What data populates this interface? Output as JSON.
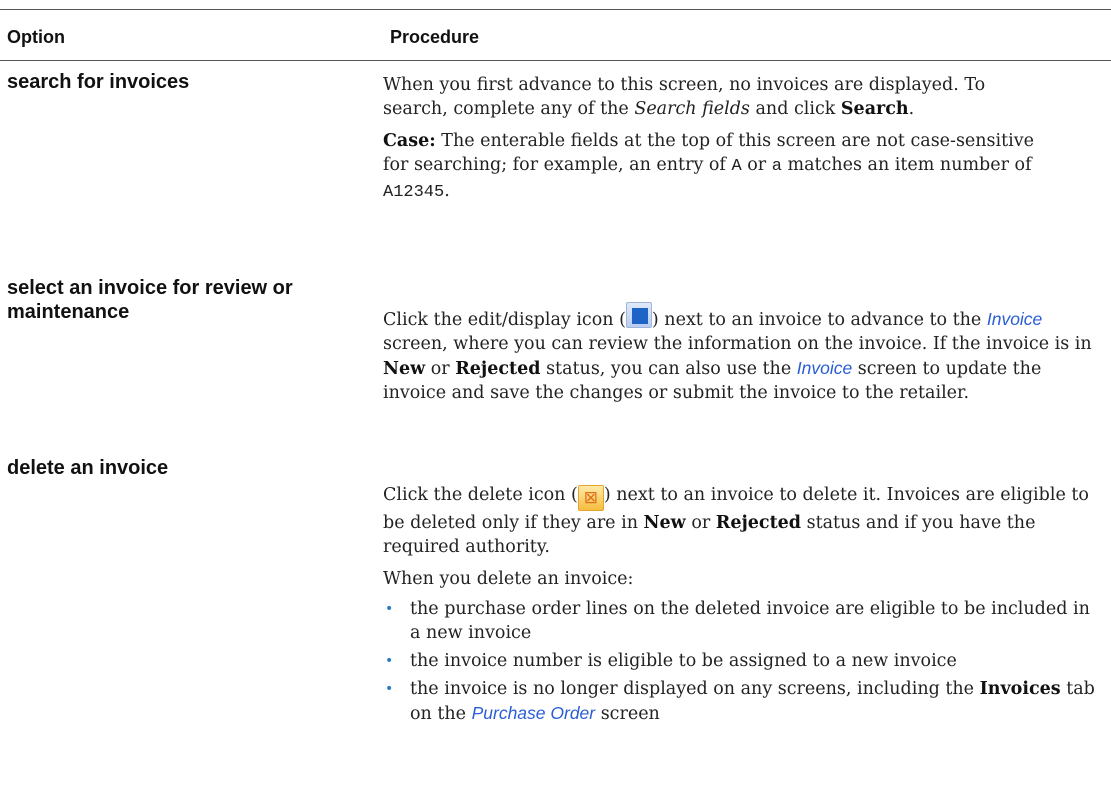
{
  "table": {
    "headers": {
      "option": "Option",
      "procedure": "Procedure"
    },
    "rows": {
      "search": {
        "option": "search for invoices",
        "p1": {
          "t1": "When you first advance to this screen, no invoices are displayed. To search, complete any of the ",
          "em": "Search fields",
          "t2": " and click ",
          "b": "Search",
          "t3": "."
        },
        "p2": {
          "label": "Case:",
          "t1": " The enterable fields at the top of this screen are not case-sensitive for searching; for example, an entry of ",
          "code1": "A",
          "t2": " or ",
          "code2": "a",
          "t3": " matches an item number of ",
          "code3": "A12345",
          "t4": "."
        }
      },
      "select": {
        "option": "select an invoice for review or maintenance",
        "p1": {
          "t1": "Click the edit/display icon (",
          "t2": ") next to an invoice to advance to the ",
          "link1": "Invoice",
          "t3": " screen, where you can review the information on the invoice. If the invoice is in ",
          "b1": "New",
          "t4": " or ",
          "b2": "Rejected",
          "t5": " status, you can also use the ",
          "link2": "Invoice",
          "t6": " screen to update the invoice and save the changes or submit the invoice to the retailer."
        }
      },
      "delete": {
        "option": "delete an invoice",
        "p1": {
          "t1": "Click the delete icon (",
          "t2": ") next to an invoice to delete it. Invoices are eligible to be deleted only if they are in ",
          "b1": "New",
          "t3": " or ",
          "b2": "Rejected",
          "t4": " status and if you have the required authority."
        },
        "p2": "When you delete an invoice:",
        "bullets": {
          "b1": "the purchase order lines on the deleted invoice are eligible to be included in a new invoice",
          "b2": "the invoice number is eligible to be assigned to a new invoice",
          "b3": {
            "t1": "the invoice is no longer displayed on any screens, including the ",
            "b": "Invoices",
            "t2": " tab on the ",
            "link": "Purchase Order",
            "t3": " screen"
          }
        }
      }
    }
  },
  "icons": {
    "edit": "edit-display-icon",
    "delete": "delete-icon",
    "bullet": "bullet-dot-icon"
  },
  "colors": {
    "link": "#2a5dd7",
    "bullet": "#2a7dc1",
    "edit_icon": "#1f63c6",
    "delete_icon": "#f5be3f"
  }
}
